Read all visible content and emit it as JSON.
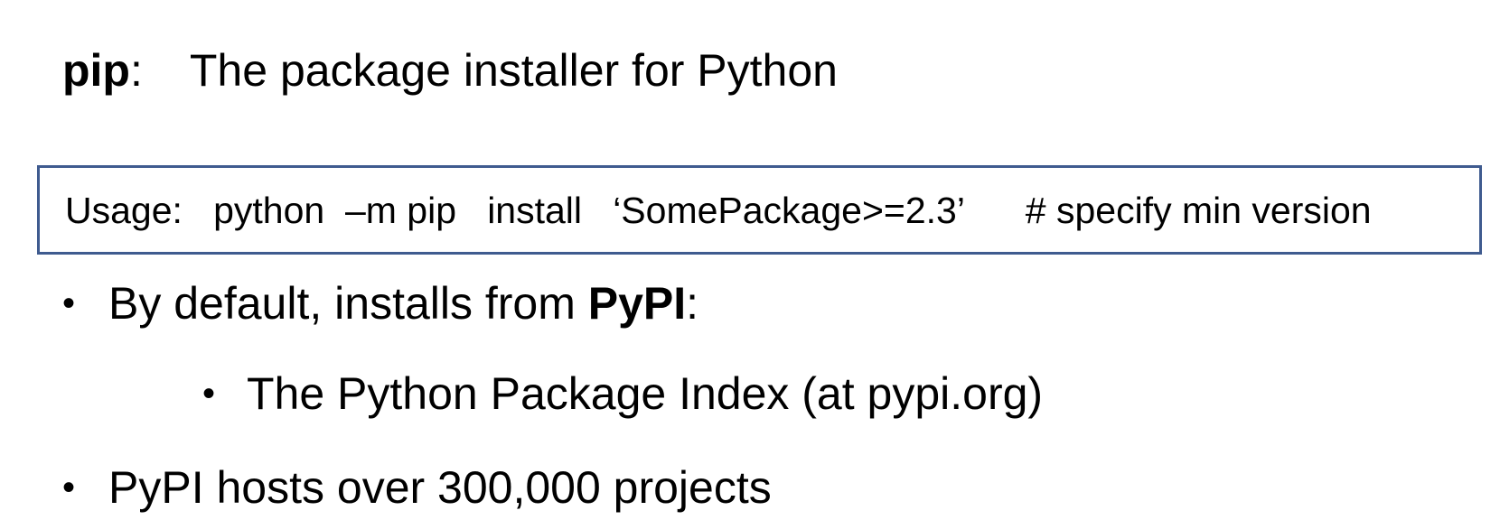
{
  "title": {
    "term": "pip",
    "colon": ":",
    "description": "The package installer for Python"
  },
  "usage": {
    "text": "Usage:   python  –m pip   install   ‘SomePackage>=2.3’      # specify min version"
  },
  "bullets": {
    "b1_prefix": "By default, installs from ",
    "b1_bold": "PyPI",
    "b1_suffix": ":",
    "b2": "The Python Package Index   (at pypi.org)",
    "b3": "PyPI hosts over 300,000 projects",
    "dot": "•"
  },
  "colors": {
    "box_border": "#3f5b8f"
  }
}
